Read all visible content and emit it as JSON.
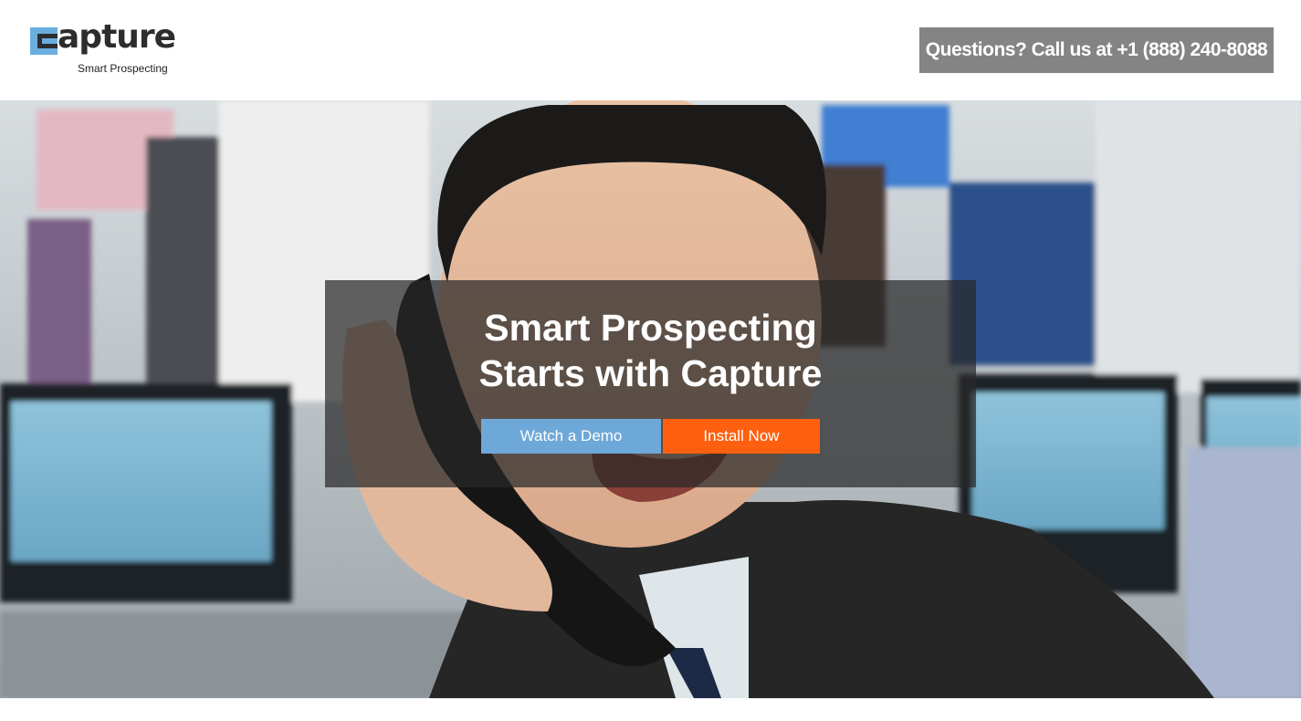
{
  "header": {
    "logo_word": "apture",
    "logo_tagline": "Smart Prospecting",
    "phone_label": "Questions? Call us at +1 (888) 240-8088"
  },
  "hero": {
    "headline_line1": "Smart Prospecting",
    "headline_line2": "Starts with Capture",
    "watch_demo_label": "Watch a Demo",
    "install_label": "Install Now"
  },
  "colors": {
    "logo_blue": "#6aaee0",
    "phone_bg": "#848484",
    "demo_button": "#6ea8d8",
    "install_button": "#ff6010",
    "overlay": "rgba(40,40,40,0.72)"
  }
}
